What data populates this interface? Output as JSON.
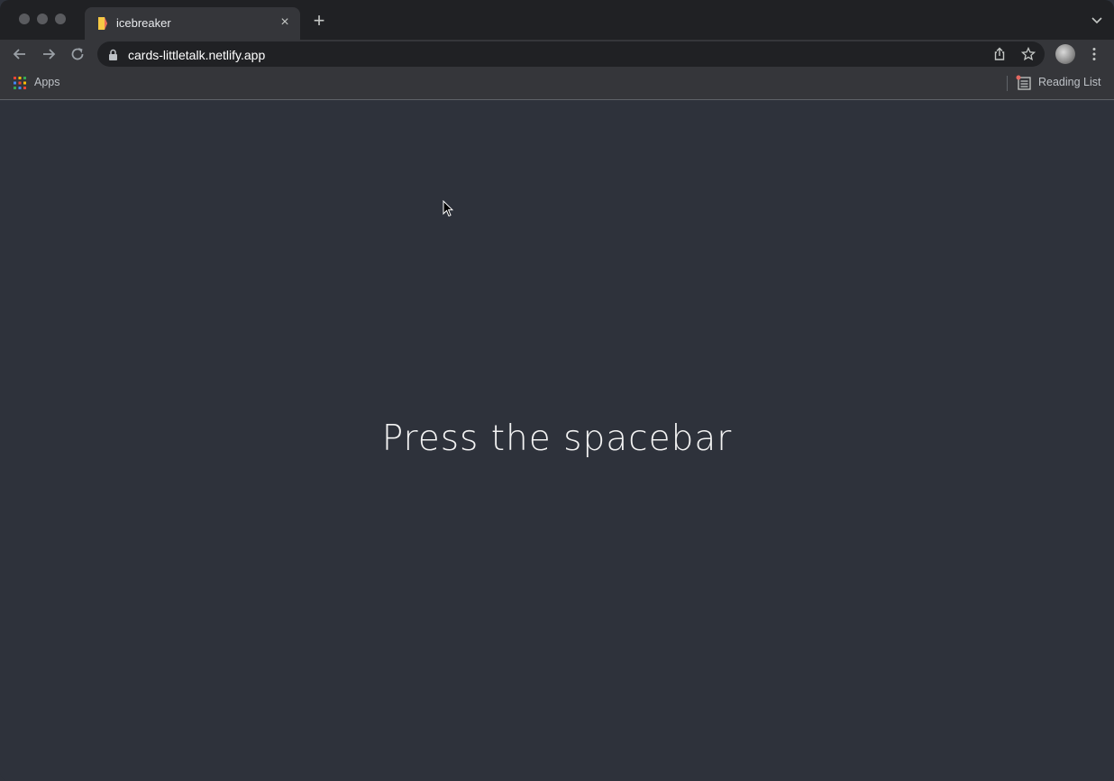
{
  "browser": {
    "tab": {
      "title": "icebreaker",
      "close_glyph": "×"
    },
    "new_tab_glyph": "+",
    "address_bar": {
      "url": "cards-littletalk.netlify.app"
    },
    "bookmarks": {
      "apps_label": "Apps",
      "reading_list_label": "Reading List"
    },
    "icons": [
      "back-arrow-icon",
      "forward-arrow-icon",
      "reload-icon",
      "lock-icon",
      "share-icon",
      "star-icon",
      "profile-avatar",
      "more-menu-icon",
      "apps-grid-icon",
      "reading-list-icon",
      "tab-list-chevron-icon"
    ]
  },
  "page": {
    "prompt_text": "Press the spacebar",
    "background_color": "#2e323b",
    "text_color": "#f2f2f2"
  }
}
